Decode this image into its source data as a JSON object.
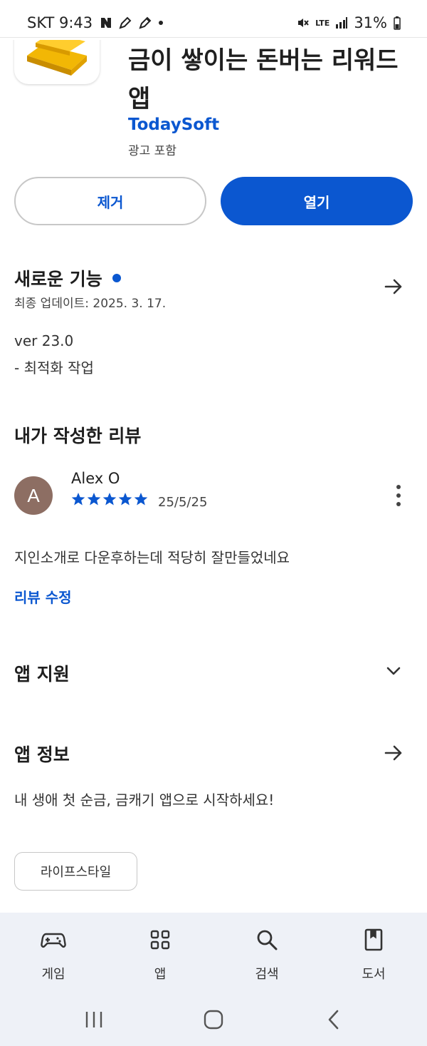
{
  "status_bar": {
    "carrier_time": "SKT 9:43",
    "network": "LTE",
    "battery": "31%"
  },
  "app": {
    "title": "금이 쌓이는 돈버는 리워드 앱",
    "developer": "TodaySoft",
    "ads_note": "광고 포함"
  },
  "buttons": {
    "remove_label": "제거",
    "open_label": "열기"
  },
  "whats_new": {
    "title": "새로운 기능",
    "updated": "최종 업데이트: 2025. 3. 17.",
    "version": "ver 23.0",
    "note": "- 최적화 작업"
  },
  "my_review": {
    "title": "내가 작성한 리뷰",
    "avatar_letter": "A",
    "reviewer": "Alex O",
    "rating": 5,
    "date": "25/5/25",
    "text": "지인소개로 다운후하는데 적당히 잘만들었네요",
    "edit_label": "리뷰 수정"
  },
  "app_support": {
    "title": "앱 지원"
  },
  "app_info": {
    "title": "앱 정보",
    "description": "내 생애 첫 순금, 금캐기 앱으로 시작하세요!",
    "category_chip": "라이프스타일"
  },
  "bottom_nav": {
    "items": [
      {
        "label": "게임",
        "icon": "gamepad-icon"
      },
      {
        "label": "앱",
        "icon": "apps-grid-icon"
      },
      {
        "label": "검색",
        "icon": "search-icon"
      },
      {
        "label": "도서",
        "icon": "book-icon"
      }
    ]
  },
  "colors": {
    "accent": "#0b57d0",
    "star": "#0b57d0",
    "avatar": "#8d6e63",
    "nav_bg": "#eef1f7"
  }
}
